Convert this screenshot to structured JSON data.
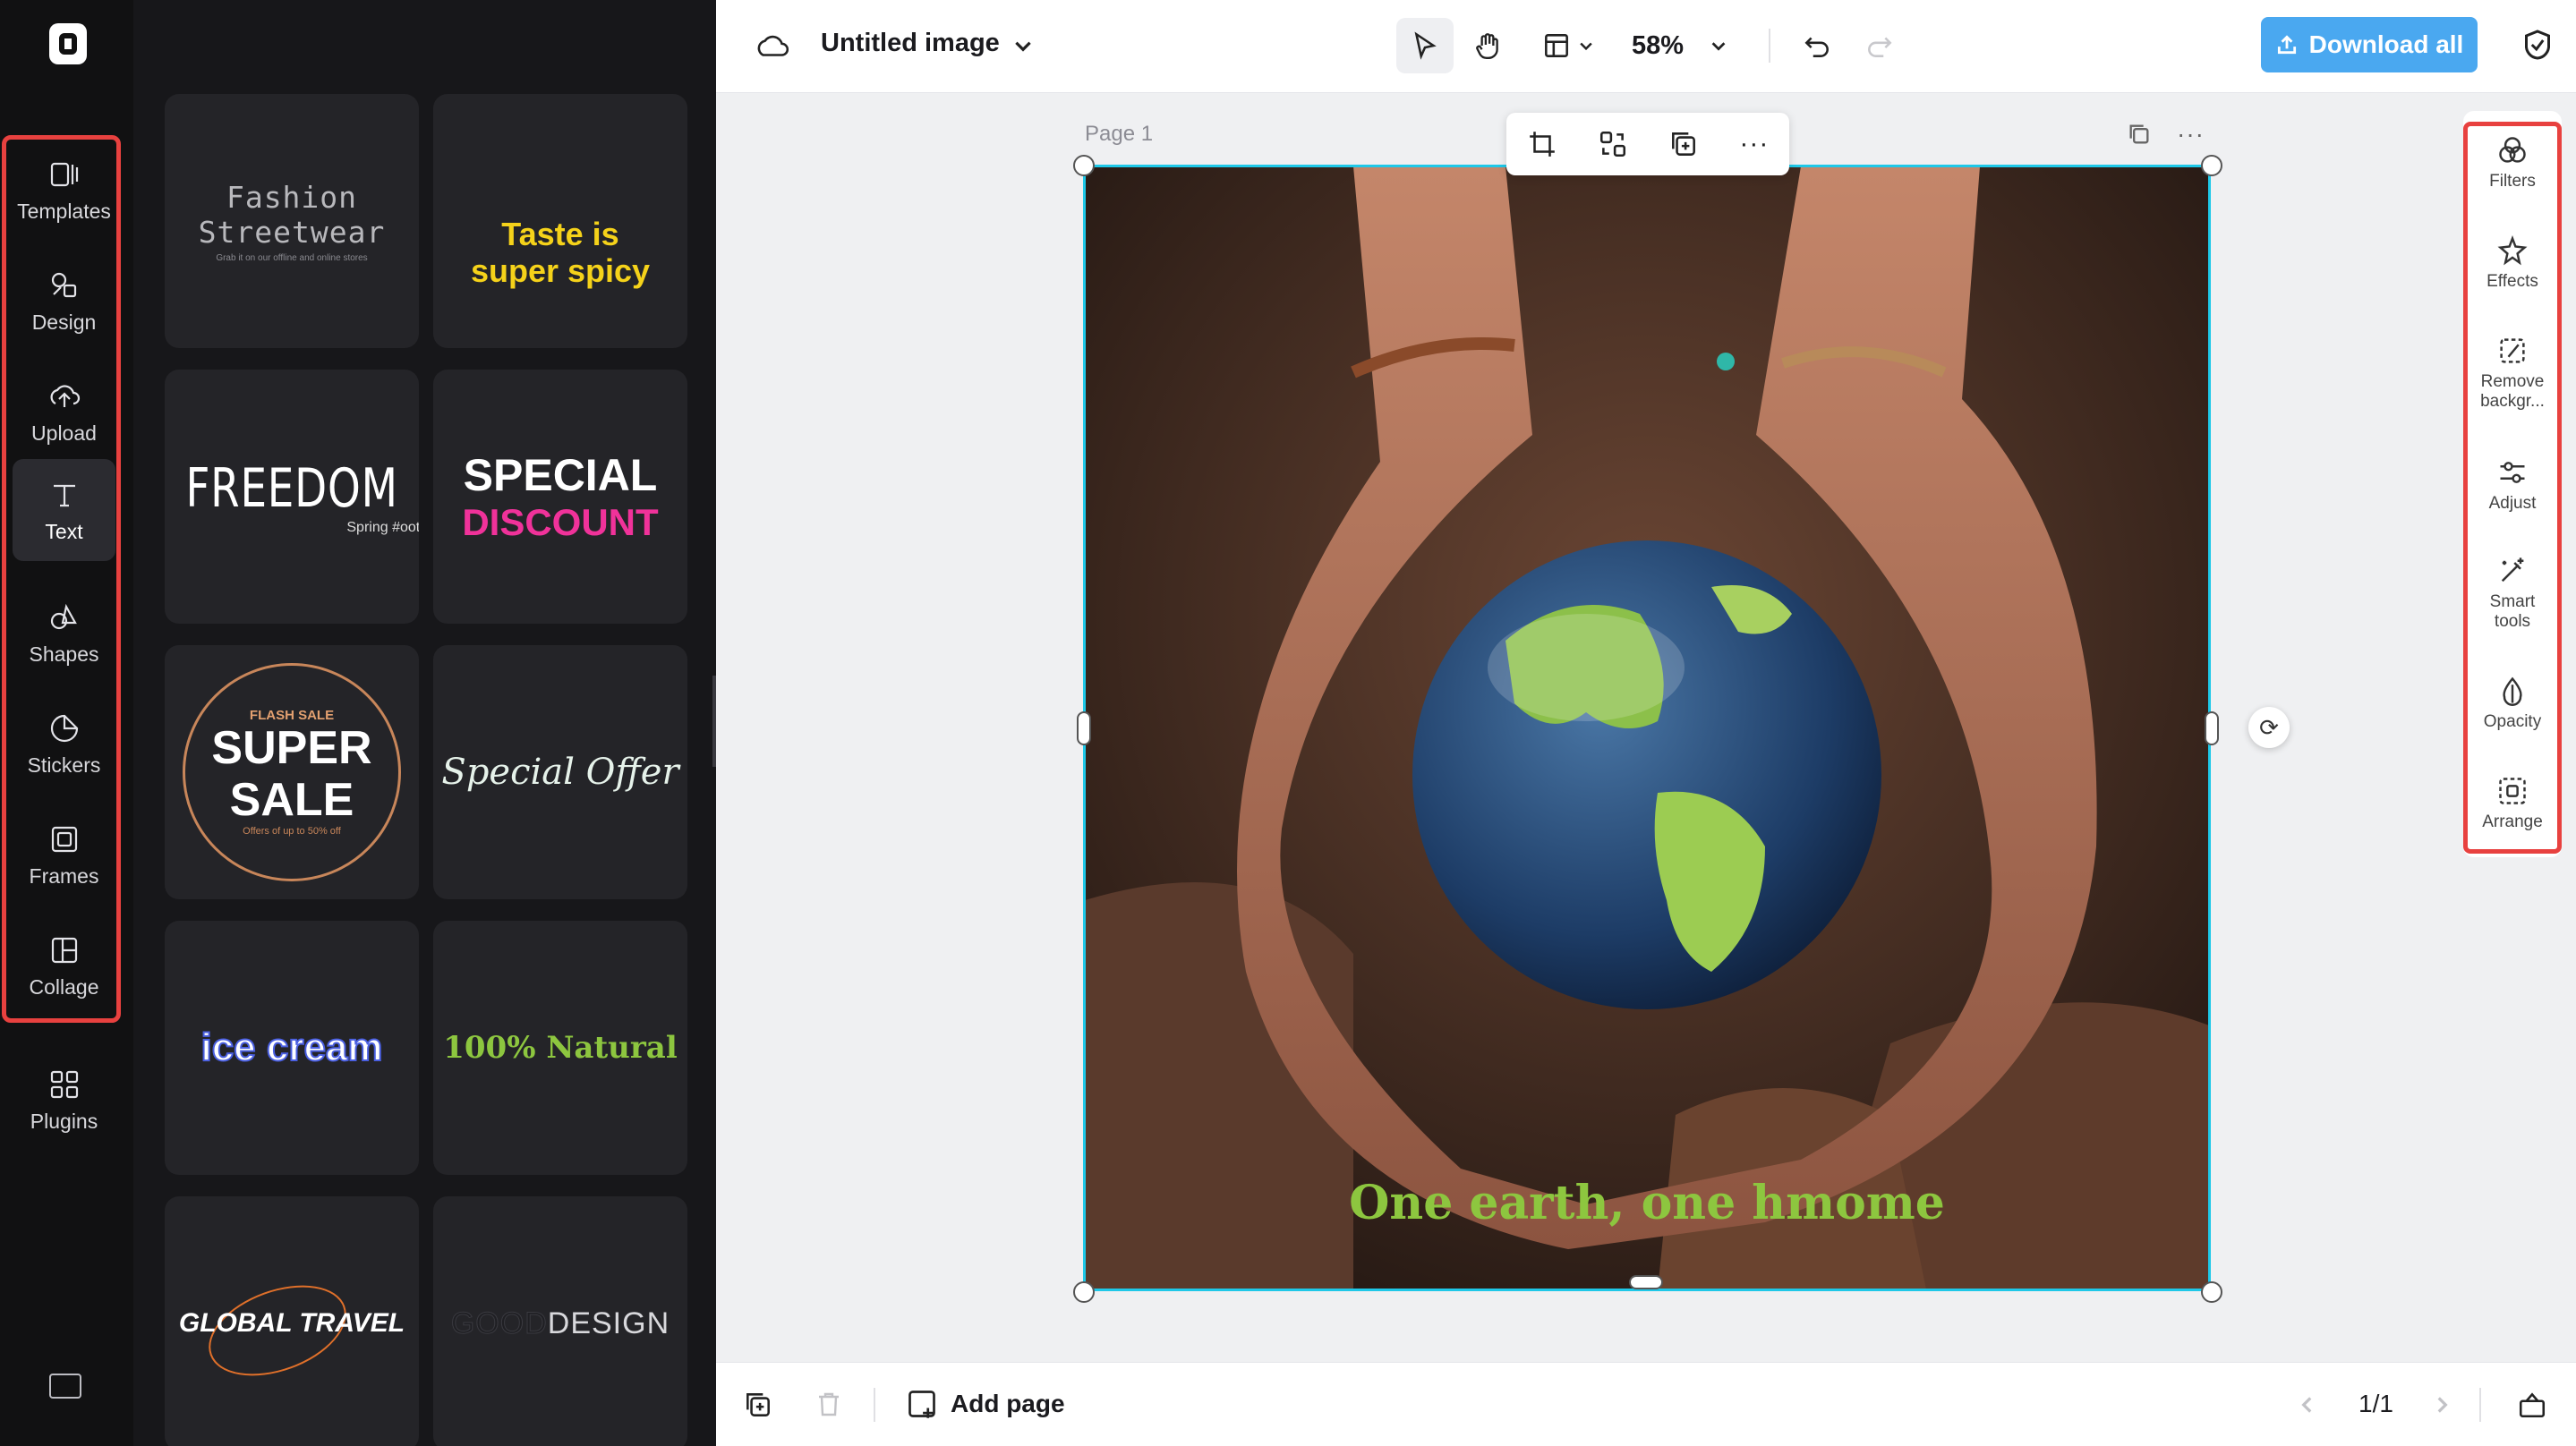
{
  "app": {
    "logo": "app-logo"
  },
  "rail": {
    "items": [
      {
        "label": "Templates",
        "icon": "templates-icon"
      },
      {
        "label": "Design",
        "icon": "design-icon"
      },
      {
        "label": "Upload",
        "icon": "upload-icon"
      },
      {
        "label": "Text",
        "icon": "text-icon",
        "active": true
      },
      {
        "label": "Shapes",
        "icon": "shapes-icon"
      },
      {
        "label": "Stickers",
        "icon": "stickers-icon"
      },
      {
        "label": "Frames",
        "icon": "frames-icon"
      },
      {
        "label": "Collage",
        "icon": "collage-icon"
      },
      {
        "label": "Plugins",
        "icon": "plugins-icon"
      }
    ]
  },
  "panel": {
    "cards": [
      {
        "title": "Fashion Streetwear",
        "sub": "Grab it on our offline and online stores"
      },
      {
        "title": "Taste is super spicy"
      },
      {
        "title": "FREEDOM",
        "sub": "Spring #ootd"
      },
      {
        "title": "SPECIAL",
        "sub": "DISCOUNT"
      },
      {
        "title": "SUPER SALE",
        "top": "FLASH SALE",
        "sub": "Offers of up to 50% off"
      },
      {
        "title": "Special Offer"
      },
      {
        "title": "ice cream"
      },
      {
        "title": "100% Natural"
      },
      {
        "title": "GLOBAL TRAVEL"
      },
      {
        "title": "GOOD",
        "sub": "DESIGN"
      }
    ]
  },
  "topbar": {
    "title": "Untitled image",
    "zoom": "58%",
    "download_label": "Download all"
  },
  "canvas": {
    "page_label": "Page 1",
    "caption": "One earth, one hmome"
  },
  "props": {
    "items": [
      {
        "label": "Filters",
        "icon": "filters-icon"
      },
      {
        "label": "Effects",
        "icon": "effects-icon"
      },
      {
        "label": "Remove backgr...",
        "icon": "remove-background-icon"
      },
      {
        "label": "Adjust",
        "icon": "adjust-icon"
      },
      {
        "label": "Smart tools",
        "icon": "smart-tools-icon"
      },
      {
        "label": "Opacity",
        "icon": "opacity-icon"
      },
      {
        "label": "Arrange",
        "icon": "arrange-icon"
      }
    ]
  },
  "bottombar": {
    "add_page": "Add page",
    "pager": "1/1"
  },
  "colors": {
    "accent": "#4aa8f0",
    "selection": "#1ec8e8",
    "highlight": "#e8413f",
    "caption": "#8dc63f"
  }
}
